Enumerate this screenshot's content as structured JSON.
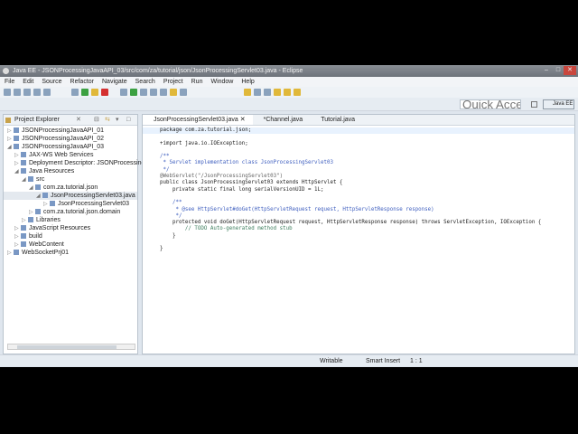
{
  "window": {
    "title": "Java EE - JSONProcessingJavaAPI_03/src/com/za/tutorial/json/JsonProcessingServlet03.java - Eclipse",
    "controls": [
      "–",
      "□",
      "✕"
    ]
  },
  "menu": [
    "File",
    "Edit",
    "Source",
    "Refactor",
    "Navigate",
    "Search",
    "Project",
    "Run",
    "Window",
    "Help"
  ],
  "quick_access": {
    "placeholder": "Quick Access"
  },
  "perspective": "Java EE",
  "explorer": {
    "title": "Project Explorer",
    "items": [
      {
        "label": "JSONProcessingJavaAPI_01",
        "level": 0,
        "tw": "▷"
      },
      {
        "label": "JSONProcessingJavaAPI_02",
        "level": 0,
        "tw": "▷"
      },
      {
        "label": "JSONProcessingJavaAPI_03",
        "level": 0,
        "tw": "◢"
      },
      {
        "label": "JAX-WS Web Services",
        "level": 1,
        "tw": "▷"
      },
      {
        "label": "Deployment Descriptor: JSONProcessingJav",
        "level": 1,
        "tw": "▷"
      },
      {
        "label": "Java Resources",
        "level": 1,
        "tw": "◢"
      },
      {
        "label": "src",
        "level": 2,
        "tw": "◢"
      },
      {
        "label": "com.za.tutorial.json",
        "level": 3,
        "tw": "◢"
      },
      {
        "label": "JsonProcessingServlet03.java",
        "level": 4,
        "tw": "◢"
      },
      {
        "label": "JsonProcessingServlet03",
        "level": 5,
        "tw": "▷"
      },
      {
        "label": "com.za.tutorial.json.domain",
        "level": 3,
        "tw": "▷"
      },
      {
        "label": "Libraries",
        "level": 2,
        "tw": "▷"
      },
      {
        "label": "JavaScript Resources",
        "level": 1,
        "tw": "▷"
      },
      {
        "label": "build",
        "level": 1,
        "tw": "▷"
      },
      {
        "label": "WebContent",
        "level": 1,
        "tw": "▷"
      },
      {
        "label": "WebSocketPrj01",
        "level": 0,
        "tw": "▷"
      }
    ]
  },
  "editor": {
    "tabs": [
      "JsonProcessingServlet03.java",
      "*Channel.java",
      "Tutorial.java"
    ],
    "lines": [
      "package com.za.tutorial.json;",
      "",
      "+import java.io.IOException;",
      "",
      "/**",
      " * Servlet implementation class JsonProcessingServlet03",
      " */",
      "@WebServlet(\"/JsonProcessingServlet03\")",
      "public class JsonProcessingServlet03 extends HttpServlet {",
      "    private static final long serialVersionUID = 1L;",
      "",
      "    /**",
      "     * @see HttpServlet#doGet(HttpServletRequest request, HttpServletResponse response)",
      "     */",
      "    protected void doGet(HttpServletRequest request, HttpServletResponse response) throws ServletException, IOException {",
      "        // TODO Auto-generated method stub",
      "    }",
      "",
      "}"
    ]
  },
  "status": {
    "mode": "Writable",
    "insert": "Smart Insert",
    "position": "1 : 1"
  }
}
